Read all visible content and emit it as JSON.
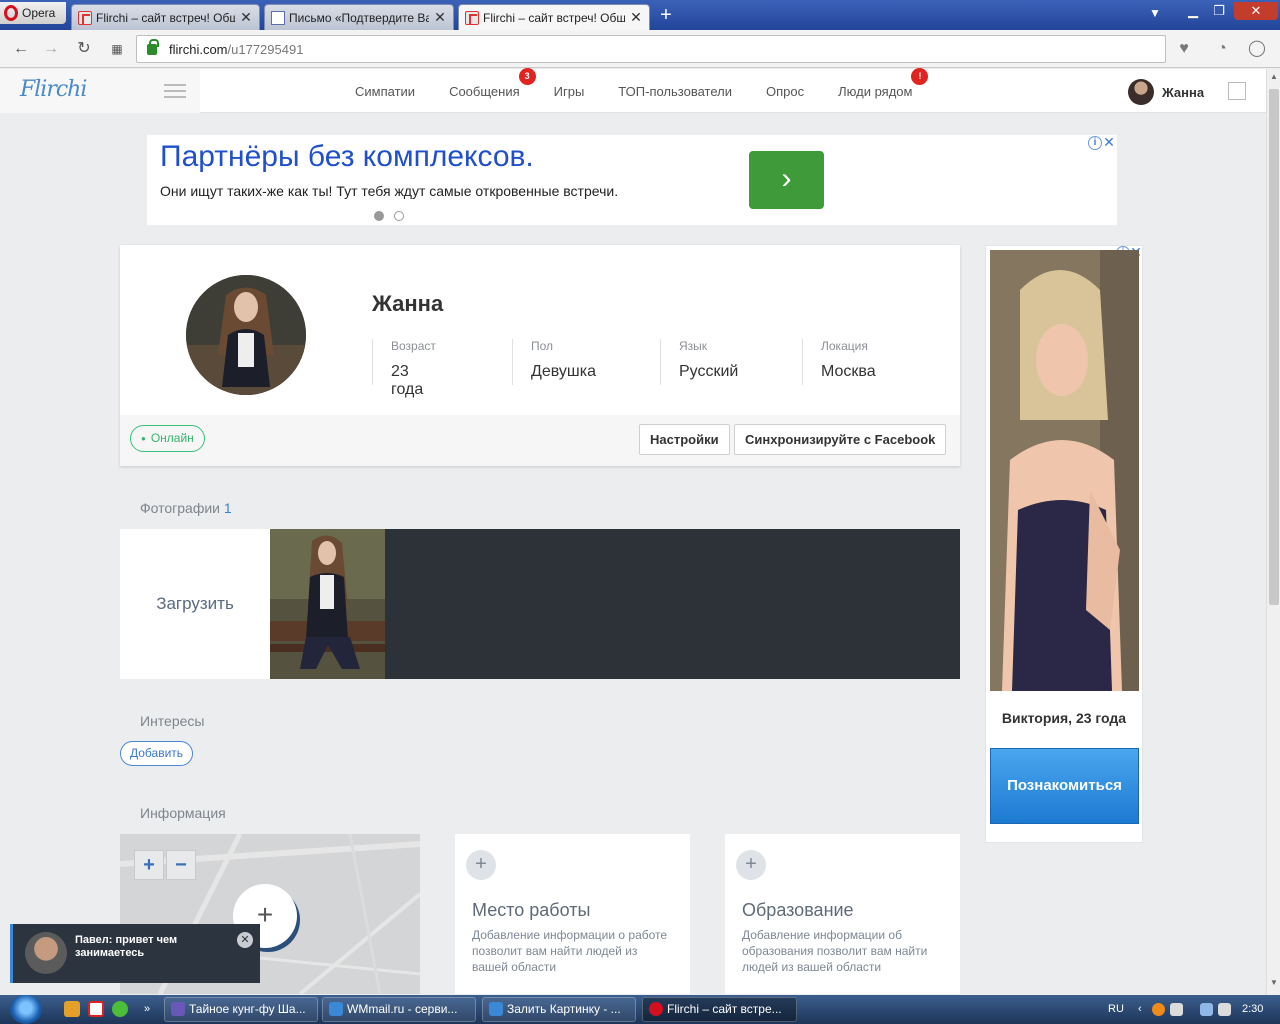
{
  "browser": {
    "app_label": "Opera",
    "tabs": [
      {
        "title": "Flirchi – сайт встреч! Общ",
        "icon": "flirchi-icon"
      },
      {
        "title": "Письмо «Подтвердите Ваш",
        "icon": "mail-icon"
      },
      {
        "title": "Flirchi – сайт встреч! Общ",
        "icon": "flirchi-icon"
      }
    ],
    "url_host": "flirchi.com",
    "url_path": "/u177295491"
  },
  "site": {
    "logo": "Flirchi",
    "menu": [
      {
        "label": "Симпатии",
        "badge": ""
      },
      {
        "label": "Сообщения",
        "badge": "3"
      },
      {
        "label": "Игры",
        "badge": ""
      },
      {
        "label": "ТОП-пользователи",
        "badge": ""
      },
      {
        "label": "Опрос",
        "badge": ""
      },
      {
        "label": "Люди рядом",
        "badge": "!"
      }
    ],
    "user_name": "Жанна"
  },
  "ad_banner": {
    "title": "Партнёры без комплексов.",
    "text": "Они ищут таких-же как ты! Тут тебя ждут самые откровенные встречи.",
    "button_glyph": "›"
  },
  "profile": {
    "name": "Жанна",
    "fields": [
      {
        "label": "Возраст",
        "value": "23 года"
      },
      {
        "label": "Пол",
        "value": "Девушка"
      },
      {
        "label": "Язык",
        "value": "Русский"
      },
      {
        "label": "Локация",
        "value": "Москва"
      }
    ],
    "status": "Онлайн",
    "settings_button": "Настройки",
    "facebook_button": "Синхронизируйте с Facebook"
  },
  "photos": {
    "title": "Фотографии",
    "count": "1",
    "upload_label": "Загрузить"
  },
  "interests": {
    "title": "Интересы",
    "add_button": "Добавить"
  },
  "information": {
    "title": "Информация",
    "map_zoom_in": "+",
    "map_zoom_out": "−",
    "cards": [
      {
        "title": "Место работы",
        "desc": "Добавление информации о работе позволит вам найти людей из вашей области"
      },
      {
        "title": "Образование",
        "desc": "Добавление информации об образования позволит вам найти людей из вашей области"
      }
    ]
  },
  "side_ad": {
    "caption": "Виктория, 23 года",
    "button": "Познакомиться"
  },
  "notification": {
    "text": "Павел: привет чем занимаетесь"
  },
  "taskbar": {
    "tasks": [
      {
        "label": "Тайное кунг-фу Ша..."
      },
      {
        "label": "WMmail.ru - серви..."
      },
      {
        "label": "Залить Картинку - ..."
      },
      {
        "label": "Flirchi – сайт встре..."
      }
    ],
    "lang": "RU",
    "time": "2:30"
  },
  "colors": {
    "accent": "#3a80d6",
    "online": "#39b06e",
    "badge": "#e0241f",
    "ad_green": "#3f9a3a",
    "photo_strip": "#2d3138"
  }
}
